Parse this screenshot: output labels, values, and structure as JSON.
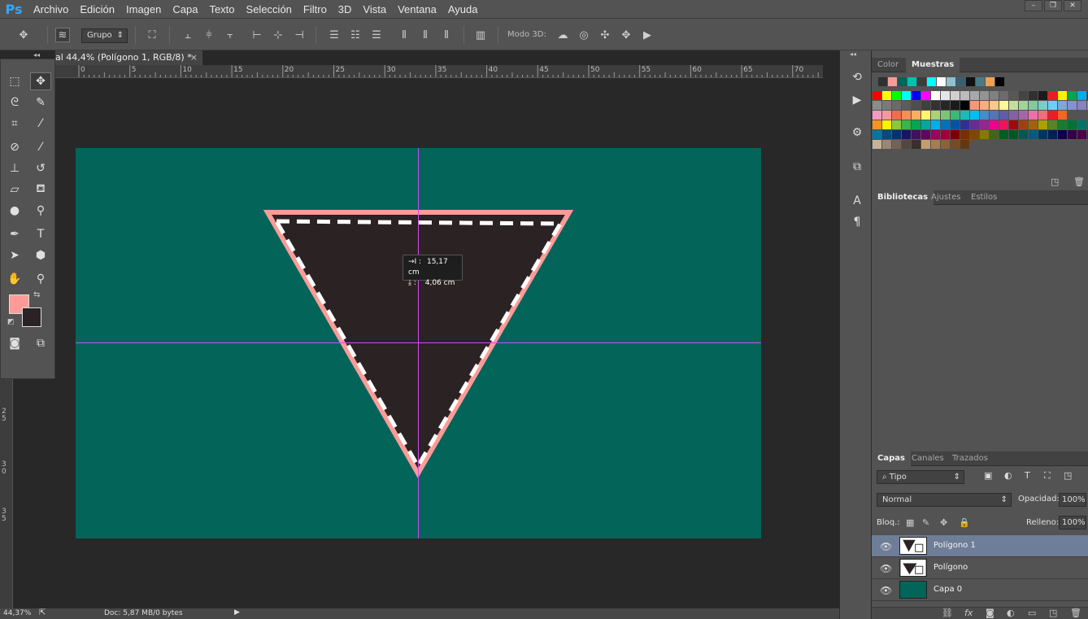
{
  "app": {
    "logo": "Ps",
    "menu": [
      "Archivo",
      "Edición",
      "Imagen",
      "Capa",
      "Texto",
      "Selección",
      "Filtro",
      "3D",
      "Vista",
      "Ventana",
      "Ayuda"
    ],
    "window_controls": [
      "–",
      "❐",
      "✕"
    ]
  },
  "options_bar": {
    "auto_select_value": "Grupo",
    "mode_3d_label": "Modo 3D:"
  },
  "document": {
    "tab_title": "al 44,4% (Polígono 1, RGB/8) *",
    "tab_close": "×",
    "canvas_color": "#03645a",
    "guide_color": "#d24cf5",
    "triangle": {
      "fill": "#2b2224",
      "stroke": "#ff9b96",
      "dash": "#ffffff"
    },
    "ruler_top_labels": [
      "0",
      "5",
      "10",
      "15",
      "20",
      "25",
      "30",
      "35",
      "40",
      "45",
      "50",
      "55",
      "60",
      "65",
      "70"
    ],
    "ruler_left_labels": [
      "2",
      "5",
      "3",
      "0",
      "3",
      "5"
    ],
    "measure_tooltip": {
      "width_label": "→I :",
      "width_value": "15,17 cm",
      "height_label": "⤓ :",
      "height_value": "4,06 cm"
    }
  },
  "toolbox": {
    "foreground_color": "#ff9b96",
    "background_color": "#2a2224"
  },
  "status_bar": {
    "zoom": "44,37%",
    "doc_info": "Doc: 5,87 MB/0 bytes"
  },
  "color_panel": {
    "tabs": [
      "Color",
      "Muestras"
    ],
    "active_tab": "Muestras",
    "recent_swatches": [
      "#2f2f2f",
      "#ff9b96",
      "#03645a",
      "#00c0b0",
      "#3c3c3c",
      "#00ffff",
      "#ffffff",
      "#8fbfd0",
      "#3a6070",
      "#111111",
      "#4a7a86",
      "#f0a050",
      "#000000"
    ],
    "swatch_rows": [
      [
        "#ff0000",
        "#ffff00",
        "#00ff00",
        "#00ffff",
        "#0000ff",
        "#ff00ff",
        "#ffffff",
        "#e6e6e6",
        "#d0d0d0",
        "#bcbcbc",
        "#a8a8a8",
        "#949494",
        "#808080",
        "#6c6c6c",
        "#585858",
        "#444444",
        "#303030",
        "#1c1c1c",
        "#ed1c24",
        "#fff200",
        "#00a651",
        "#00aeef",
        "#2e3192",
        "#ec008c"
      ],
      [
        "#8c8c8c",
        "#7a7a7a",
        "#6a6a6a",
        "#5c5c5c",
        "#4e4e4e",
        "#404040",
        "#333333",
        "#262626",
        "#1a1a1a",
        "#000000",
        "#f7977a",
        "#f9ad81",
        "#fdc68a",
        "#fff79a",
        "#c4df9b",
        "#a2d39c",
        "#82ca9d",
        "#7bcdc8",
        "#6ecff6",
        "#7ea7d8",
        "#8493ca",
        "#8882be",
        "#a187be",
        "#bc8dbf"
      ],
      [
        "#f49ac2",
        "#f6989d",
        "#f26c4f",
        "#f68e56",
        "#fbaf5d",
        "#fff568",
        "#acd373",
        "#7cc576",
        "#3cb878",
        "#1cbbb4",
        "#00bff3",
        "#448ccb",
        "#5574b9",
        "#605ca8",
        "#8560a8",
        "#a864a8",
        "#f06eaa",
        "#f26d7d",
        "#ed1c24",
        "#f26522"
      ],
      [
        "#f7941d",
        "#fff200",
        "#8dc63f",
        "#39b54a",
        "#00a651",
        "#00a99d",
        "#00aeef",
        "#0072bc",
        "#0054a6",
        "#2e3192",
        "#662d91",
        "#92278f",
        "#ec008c",
        "#ed145b",
        "#9e0b0f",
        "#a0410d",
        "#a36209",
        "#aba000",
        "#598527",
        "#1a7b30",
        "#007236",
        "#00746b"
      ],
      [
        "#0076a3",
        "#004b80",
        "#003471",
        "#1b1464",
        "#440e62",
        "#630460",
        "#9e005d",
        "#9e0039",
        "#790000",
        "#7b2e00",
        "#7d4900",
        "#827b00",
        "#406618",
        "#005e20",
        "#005826",
        "#005952",
        "#005b7f",
        "#003663",
        "#002157",
        "#0d004c",
        "#32004b",
        "#4b0049",
        "#7b0046",
        "#7a0026"
      ],
      [
        "#c7b299",
        "#998675",
        "#736357",
        "#534741",
        "#37302d",
        "#c69c6d",
        "#a67c52",
        "#8c6239",
        "#754c24",
        "#603913"
      ]
    ]
  },
  "library_panel": {
    "tabs": [
      "Bibliotecas",
      "Ajustes",
      "Estilos"
    ],
    "active_tab": "Bibliotecas"
  },
  "layers_panel": {
    "tabs": [
      "Capas",
      "Canales",
      "Trazados"
    ],
    "active_tab": "Capas",
    "filter_label": "⌕ Tipo",
    "blend_mode": "Normal",
    "opacity_label": "Opacidad:",
    "opacity_value": "100%",
    "lock_label": "Bloq.:",
    "fill_label": "Relleno:",
    "fill_value": "100%",
    "layers": [
      {
        "name": "Polígono 1",
        "selected": true,
        "thumb": "triangle"
      },
      {
        "name": "Polígono",
        "selected": false,
        "thumb": "triangle"
      },
      {
        "name": "Capa 0",
        "selected": false,
        "thumb": "#03645a"
      }
    ],
    "footer_icons": [
      "link-icon",
      "fx-icon",
      "mask-icon",
      "adjustment-icon",
      "group-icon",
      "new-layer-icon",
      "trash-icon"
    ]
  }
}
